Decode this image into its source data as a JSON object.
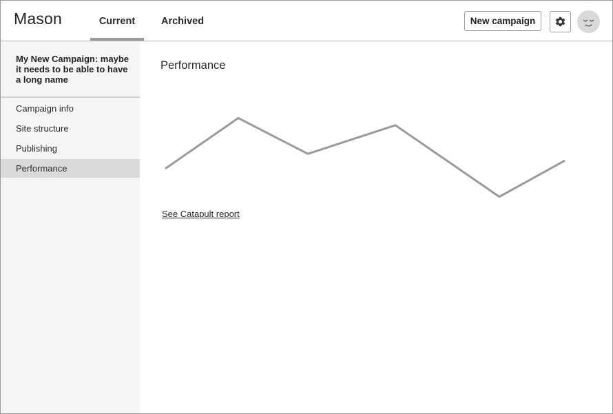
{
  "header": {
    "logo": "Mason",
    "tabs": [
      {
        "label": "Current",
        "active": true
      },
      {
        "label": "Archived",
        "active": false
      }
    ],
    "new_campaign_label": "New campaign",
    "settings_icon": "gear-icon",
    "avatar_icon": "sleepy-face-icon"
  },
  "sidebar": {
    "campaign_title": "My New Campaign: maybe it needs to be able to have a long name",
    "items": [
      {
        "label": "Campaign info",
        "active": false
      },
      {
        "label": "Site structure",
        "active": false
      },
      {
        "label": "Publishing",
        "active": false
      },
      {
        "label": "Performance",
        "active": true
      }
    ]
  },
  "main": {
    "title": "Performance",
    "report_link": "See Catapult report"
  },
  "chart_data": {
    "type": "line",
    "title": "",
    "xlabel": "",
    "ylabel": "",
    "x": [
      0,
      1,
      2,
      3,
      4,
      5
    ],
    "values": [
      0.3,
      1.0,
      0.5,
      0.9,
      -0.1,
      0.4
    ],
    "ylim": [
      -0.2,
      1.1
    ],
    "grid": false,
    "color": "#9a9a9a"
  },
  "colors": {
    "border": "#9a9a9a",
    "sidebar_bg": "#f5f5f5",
    "sidebar_active_bg": "#dadada",
    "avatar_bg": "#d9d9d9",
    "line": "#9a9a9a"
  }
}
